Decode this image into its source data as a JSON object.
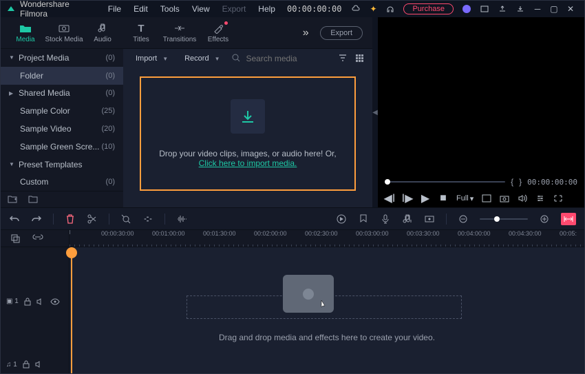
{
  "title": {
    "appname": "Wondershare Filmora"
  },
  "menu": {
    "file": "File",
    "edit": "Edit",
    "tools": "Tools",
    "view": "View",
    "export": "Export",
    "help": "Help"
  },
  "titlebar": {
    "timecode": "00:00:00:00",
    "purchase": "Purchase"
  },
  "tabs": {
    "media": "Media",
    "stock": "Stock Media",
    "audio": "Audio",
    "titles": "Titles",
    "transitions": "Transitions",
    "effects": "Effects",
    "export": "Export"
  },
  "side": {
    "items": [
      {
        "label": "Project Media",
        "count": "(0)",
        "caret": "▼"
      },
      {
        "label": "Folder",
        "count": "(0)",
        "indent": true,
        "selected": true
      },
      {
        "label": "Shared Media",
        "count": "(0)",
        "caret": "▶"
      },
      {
        "label": "Sample Color",
        "count": "(25)",
        "indent": true
      },
      {
        "label": "Sample Video",
        "count": "(20)",
        "indent": true
      },
      {
        "label": "Sample Green Scre...",
        "count": "(10)",
        "indent": true
      },
      {
        "label": "Preset Templates",
        "count": "",
        "caret": "▼"
      },
      {
        "label": "Custom",
        "count": "(0)",
        "indent": true
      }
    ]
  },
  "toolbar": {
    "import": "Import",
    "record": "Record",
    "search_placeholder": "Search media"
  },
  "dropzone": {
    "text": "Drop your video clips, images, or audio here! Or,",
    "link": "Click here to import media."
  },
  "preview": {
    "curly_l": "{",
    "curly_r": "}",
    "timecode": "00:00:00:00",
    "zoom": "Full",
    "zoom_caret": "▾"
  },
  "ruler": {
    "ticks": [
      "00:00:30:00",
      "00:01:00:00",
      "00:01:30:00",
      "00:02:00:00",
      "00:02:30:00",
      "00:03:00:00",
      "00:03:30:00",
      "00:04:00:00",
      "00:04:30:00",
      "00:05:"
    ]
  },
  "trackhead": {
    "v1": "▣ 1",
    "a1": "♫ 1"
  },
  "tracks": {
    "hint": "Drag and drop media and effects here to create your video."
  }
}
